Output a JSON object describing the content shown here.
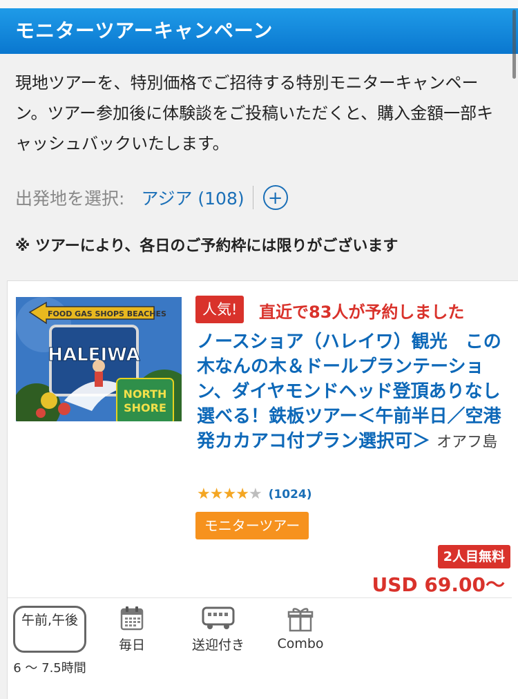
{
  "header": {
    "title": "モニターツアーキャンペーン"
  },
  "intro": {
    "text": "現地ツアーを、特別価格でご招待する特別モニターキャンペーン。ツアー参加後に体験談をご投稿いただくと、購入金額一部キャッシュバックいたします。"
  },
  "origin": {
    "label": "出発地を選択:",
    "value": "アジア (108)",
    "add_symbol": "+"
  },
  "notice": "※ ツアーにより、各日のご予約枠には限りがございます",
  "tour": {
    "image": {
      "sign_top": "FOOD GAS SHOPS BEACHES",
      "sign_main": "HALEIWA",
      "sign_sub1": "NORTH",
      "sign_sub2": "SHORE"
    },
    "popular_badge": "人気!",
    "booked_text": "直近で83人が予約しました",
    "title": "ノースショア（ハレイワ）観光　この木なんの木＆ドールプランテーション、ダイヤモンドヘッド登頂ありなし選べる！鉄板ツアー＜午前半日／空港発カカアコ付プラン選択可＞",
    "region": "オアフ島",
    "rating": {
      "value": 4,
      "max": 5,
      "count": "(1024)"
    },
    "monitor_badge": "モニターツアー",
    "free_badge": "2人目無料",
    "price": "USD 69.00〜"
  },
  "features": {
    "time_of_day": "午前,午後",
    "duration": "6 〜 7.5時間",
    "daily": "毎日",
    "pickup": "送迎付き",
    "combo": "Combo"
  },
  "colors": {
    "header_blue": "#0a77cf",
    "link_blue": "#1a6fb7",
    "accent_red": "#d9322b",
    "badge_orange": "#f6921e",
    "star_gold": "#f4a623"
  }
}
